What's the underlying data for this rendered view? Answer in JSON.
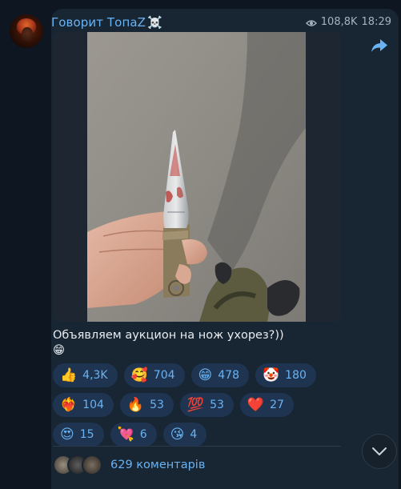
{
  "post": {
    "channel_name": "Говорит ТопаZ",
    "channel_badge": "☠️",
    "views": "108,8K",
    "time": "18:29",
    "caption_line1": "Объявляем аукцион на нож ухорез?))",
    "caption_line2": "😁"
  },
  "reactions": [
    {
      "emoji": "👍",
      "count": "4,3K"
    },
    {
      "emoji": "🥰",
      "count": "704"
    },
    {
      "emoji": "😁",
      "count": "478"
    },
    {
      "emoji": "🤡",
      "count": "180"
    },
    {
      "emoji": "❤️‍🔥",
      "count": "104"
    },
    {
      "emoji": "🔥",
      "count": "53"
    },
    {
      "emoji": "💯",
      "count": "53"
    },
    {
      "emoji": "❤️",
      "count": "27"
    },
    {
      "emoji": "😍",
      "count": "15"
    },
    {
      "emoji": "💘",
      "count": "6"
    },
    {
      "emoji": "😘",
      "count": "4"
    }
  ],
  "comments": {
    "label": "629 коментарів"
  },
  "icons": {
    "views": "eye-icon",
    "share": "share-arrow-icon",
    "scroll": "chevron-down-icon"
  },
  "colors": {
    "background": "#0e1621",
    "bubble": "#182533",
    "accent": "#6ab3f3",
    "chip": "#1e3450"
  }
}
